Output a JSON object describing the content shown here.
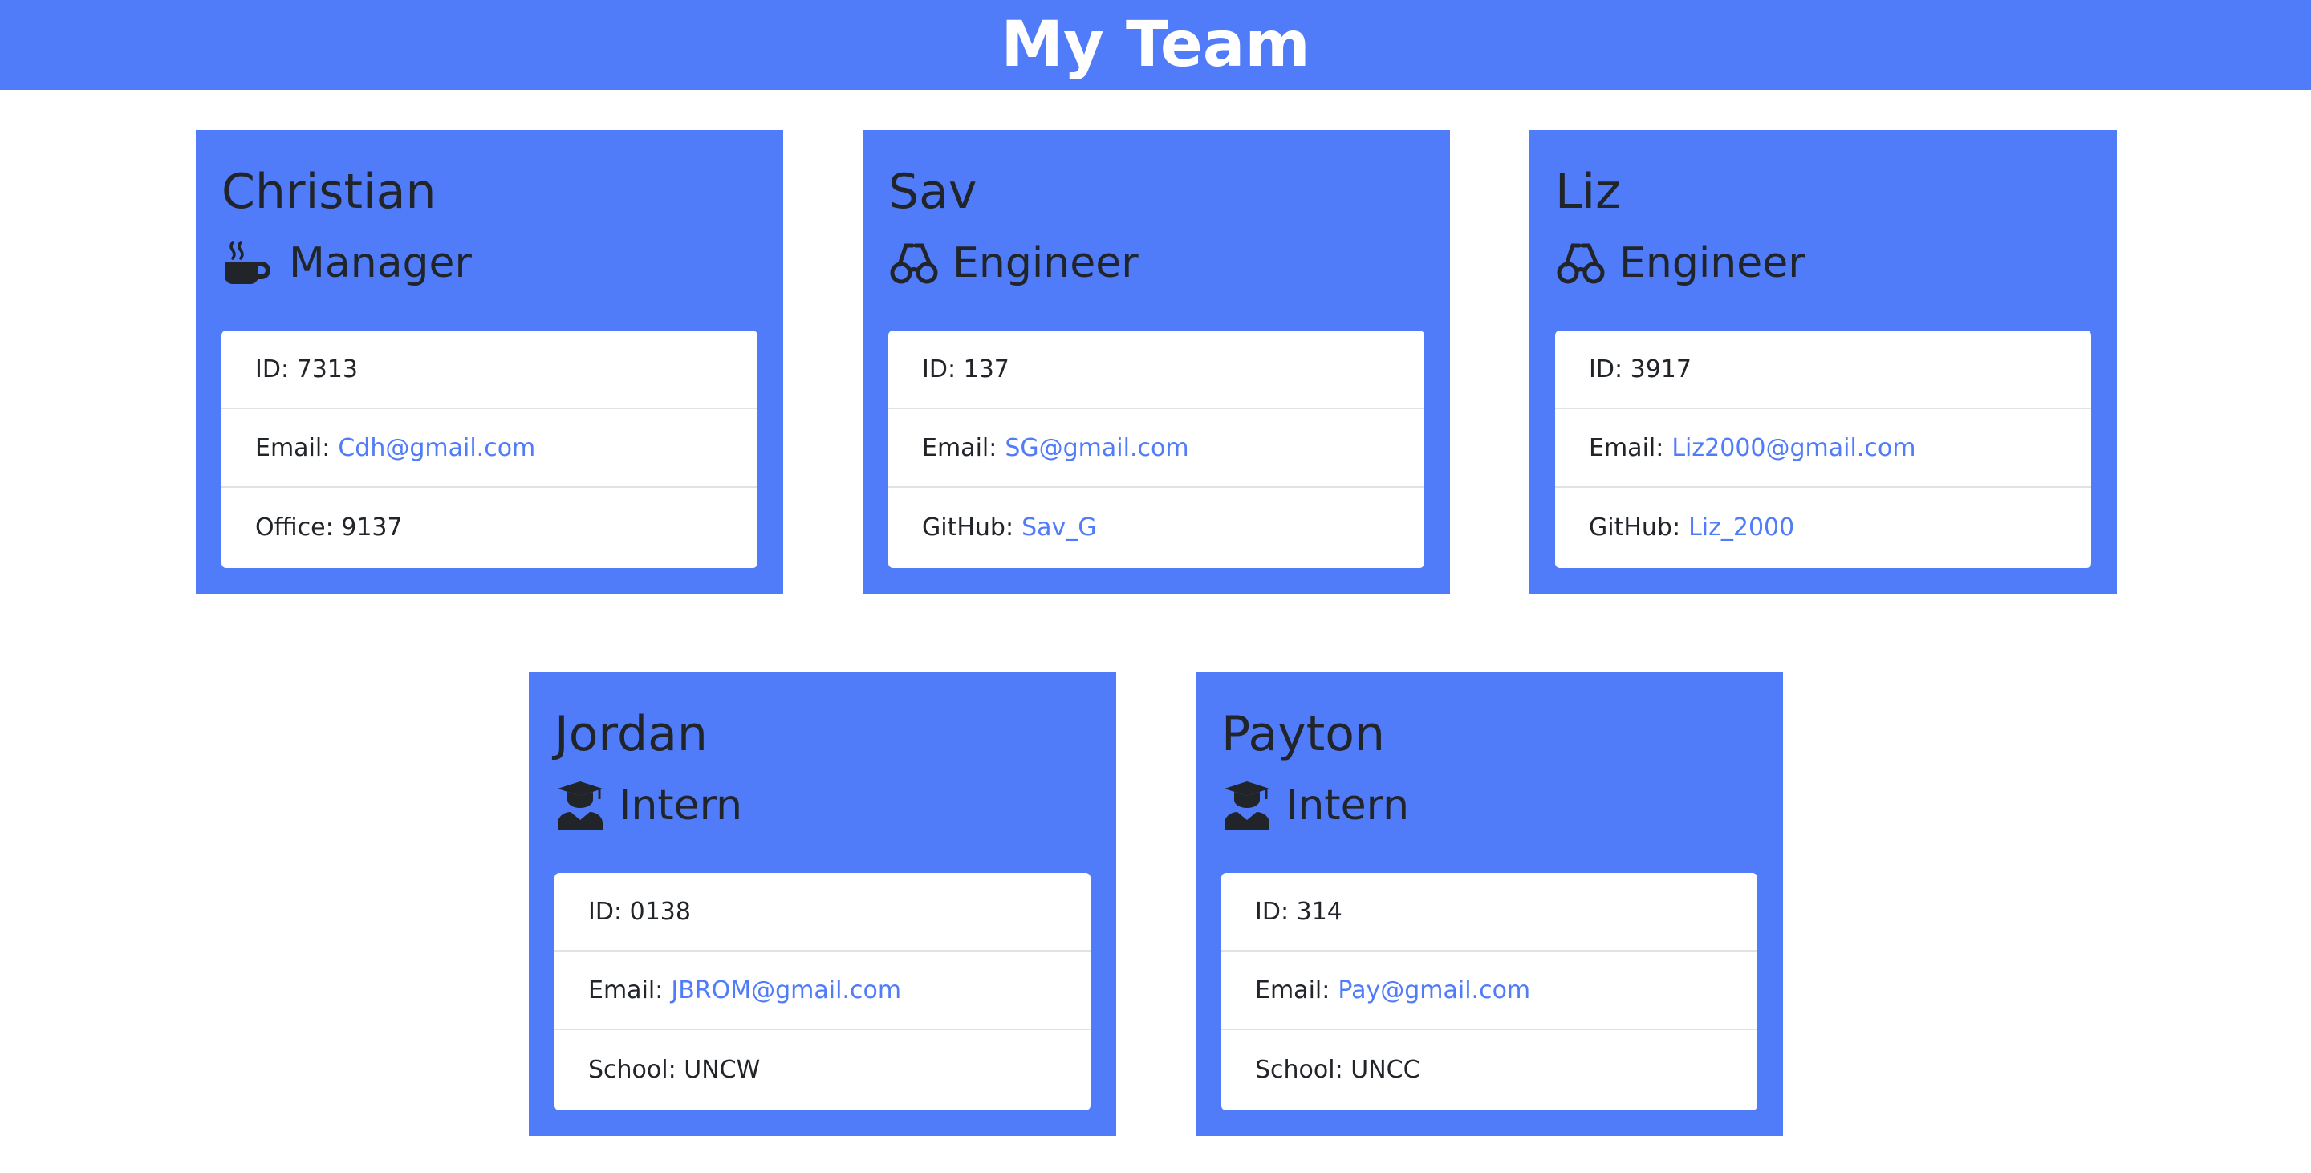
{
  "header": {
    "title": "My Team"
  },
  "colors": {
    "accent": "#517cf9",
    "text": "#212529",
    "link": "#517cf9"
  },
  "team": [
    {
      "name": "Christian",
      "role": "Manager",
      "icon": "mug-hot-icon",
      "id_label": "ID:",
      "id": "7313",
      "email_label": "Email:",
      "email": "Cdh@gmail.com",
      "extra_label": "Office:",
      "extra": "9137"
    },
    {
      "name": "Sav",
      "role": "Engineer",
      "icon": "glasses-icon",
      "id_label": "ID:",
      "id": "137",
      "email_label": "Email:",
      "email": "SG@gmail.com",
      "extra_label": "GitHub:",
      "extra": "Sav_G"
    },
    {
      "name": "Liz",
      "role": "Engineer",
      "icon": "glasses-icon",
      "id_label": "ID:",
      "id": "3917",
      "email_label": "Email:",
      "email": "Liz2000@gmail.com",
      "extra_label": "GitHub:",
      "extra": "Liz_2000"
    },
    {
      "name": "Jordan",
      "role": "Intern",
      "icon": "graduate-icon",
      "id_label": "ID:",
      "id": "0138",
      "email_label": "Email:",
      "email": "JBROM@gmail.com",
      "extra_label": "School:",
      "extra": "UNCW"
    },
    {
      "name": "Payton",
      "role": "Intern",
      "icon": "graduate-icon",
      "id_label": "ID:",
      "id": "314",
      "email_label": "Email:",
      "email": "Pay@gmail.com",
      "extra_label": "School:",
      "extra": "UNCC"
    }
  ]
}
